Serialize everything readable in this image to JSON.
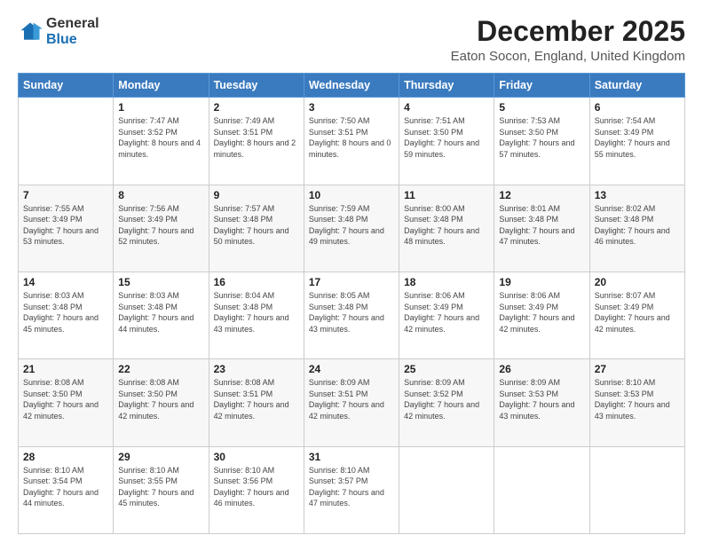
{
  "header": {
    "logo_line1": "General",
    "logo_line2": "Blue",
    "title": "December 2025",
    "subtitle": "Eaton Socon, England, United Kingdom"
  },
  "weekdays": [
    "Sunday",
    "Monday",
    "Tuesday",
    "Wednesday",
    "Thursday",
    "Friday",
    "Saturday"
  ],
  "weeks": [
    [
      {
        "day": "",
        "rise": "",
        "set": "",
        "daylight": ""
      },
      {
        "day": "1",
        "rise": "Sunrise: 7:47 AM",
        "set": "Sunset: 3:52 PM",
        "daylight": "Daylight: 8 hours and 4 minutes."
      },
      {
        "day": "2",
        "rise": "Sunrise: 7:49 AM",
        "set": "Sunset: 3:51 PM",
        "daylight": "Daylight: 8 hours and 2 minutes."
      },
      {
        "day": "3",
        "rise": "Sunrise: 7:50 AM",
        "set": "Sunset: 3:51 PM",
        "daylight": "Daylight: 8 hours and 0 minutes."
      },
      {
        "day": "4",
        "rise": "Sunrise: 7:51 AM",
        "set": "Sunset: 3:50 PM",
        "daylight": "Daylight: 7 hours and 59 minutes."
      },
      {
        "day": "5",
        "rise": "Sunrise: 7:53 AM",
        "set": "Sunset: 3:50 PM",
        "daylight": "Daylight: 7 hours and 57 minutes."
      },
      {
        "day": "6",
        "rise": "Sunrise: 7:54 AM",
        "set": "Sunset: 3:49 PM",
        "daylight": "Daylight: 7 hours and 55 minutes."
      }
    ],
    [
      {
        "day": "7",
        "rise": "Sunrise: 7:55 AM",
        "set": "Sunset: 3:49 PM",
        "daylight": "Daylight: 7 hours and 53 minutes."
      },
      {
        "day": "8",
        "rise": "Sunrise: 7:56 AM",
        "set": "Sunset: 3:49 PM",
        "daylight": "Daylight: 7 hours and 52 minutes."
      },
      {
        "day": "9",
        "rise": "Sunrise: 7:57 AM",
        "set": "Sunset: 3:48 PM",
        "daylight": "Daylight: 7 hours and 50 minutes."
      },
      {
        "day": "10",
        "rise": "Sunrise: 7:59 AM",
        "set": "Sunset: 3:48 PM",
        "daylight": "Daylight: 7 hours and 49 minutes."
      },
      {
        "day": "11",
        "rise": "Sunrise: 8:00 AM",
        "set": "Sunset: 3:48 PM",
        "daylight": "Daylight: 7 hours and 48 minutes."
      },
      {
        "day": "12",
        "rise": "Sunrise: 8:01 AM",
        "set": "Sunset: 3:48 PM",
        "daylight": "Daylight: 7 hours and 47 minutes."
      },
      {
        "day": "13",
        "rise": "Sunrise: 8:02 AM",
        "set": "Sunset: 3:48 PM",
        "daylight": "Daylight: 7 hours and 46 minutes."
      }
    ],
    [
      {
        "day": "14",
        "rise": "Sunrise: 8:03 AM",
        "set": "Sunset: 3:48 PM",
        "daylight": "Daylight: 7 hours and 45 minutes."
      },
      {
        "day": "15",
        "rise": "Sunrise: 8:03 AM",
        "set": "Sunset: 3:48 PM",
        "daylight": "Daylight: 7 hours and 44 minutes."
      },
      {
        "day": "16",
        "rise": "Sunrise: 8:04 AM",
        "set": "Sunset: 3:48 PM",
        "daylight": "Daylight: 7 hours and 43 minutes."
      },
      {
        "day": "17",
        "rise": "Sunrise: 8:05 AM",
        "set": "Sunset: 3:48 PM",
        "daylight": "Daylight: 7 hours and 43 minutes."
      },
      {
        "day": "18",
        "rise": "Sunrise: 8:06 AM",
        "set": "Sunset: 3:49 PM",
        "daylight": "Daylight: 7 hours and 42 minutes."
      },
      {
        "day": "19",
        "rise": "Sunrise: 8:06 AM",
        "set": "Sunset: 3:49 PM",
        "daylight": "Daylight: 7 hours and 42 minutes."
      },
      {
        "day": "20",
        "rise": "Sunrise: 8:07 AM",
        "set": "Sunset: 3:49 PM",
        "daylight": "Daylight: 7 hours and 42 minutes."
      }
    ],
    [
      {
        "day": "21",
        "rise": "Sunrise: 8:08 AM",
        "set": "Sunset: 3:50 PM",
        "daylight": "Daylight: 7 hours and 42 minutes."
      },
      {
        "day": "22",
        "rise": "Sunrise: 8:08 AM",
        "set": "Sunset: 3:50 PM",
        "daylight": "Daylight: 7 hours and 42 minutes."
      },
      {
        "day": "23",
        "rise": "Sunrise: 8:08 AM",
        "set": "Sunset: 3:51 PM",
        "daylight": "Daylight: 7 hours and 42 minutes."
      },
      {
        "day": "24",
        "rise": "Sunrise: 8:09 AM",
        "set": "Sunset: 3:51 PM",
        "daylight": "Daylight: 7 hours and 42 minutes."
      },
      {
        "day": "25",
        "rise": "Sunrise: 8:09 AM",
        "set": "Sunset: 3:52 PM",
        "daylight": "Daylight: 7 hours and 42 minutes."
      },
      {
        "day": "26",
        "rise": "Sunrise: 8:09 AM",
        "set": "Sunset: 3:53 PM",
        "daylight": "Daylight: 7 hours and 43 minutes."
      },
      {
        "day": "27",
        "rise": "Sunrise: 8:10 AM",
        "set": "Sunset: 3:53 PM",
        "daylight": "Daylight: 7 hours and 43 minutes."
      }
    ],
    [
      {
        "day": "28",
        "rise": "Sunrise: 8:10 AM",
        "set": "Sunset: 3:54 PM",
        "daylight": "Daylight: 7 hours and 44 minutes."
      },
      {
        "day": "29",
        "rise": "Sunrise: 8:10 AM",
        "set": "Sunset: 3:55 PM",
        "daylight": "Daylight: 7 hours and 45 minutes."
      },
      {
        "day": "30",
        "rise": "Sunrise: 8:10 AM",
        "set": "Sunset: 3:56 PM",
        "daylight": "Daylight: 7 hours and 46 minutes."
      },
      {
        "day": "31",
        "rise": "Sunrise: 8:10 AM",
        "set": "Sunset: 3:57 PM",
        "daylight": "Daylight: 7 hours and 47 minutes."
      },
      {
        "day": "",
        "rise": "",
        "set": "",
        "daylight": ""
      },
      {
        "day": "",
        "rise": "",
        "set": "",
        "daylight": ""
      },
      {
        "day": "",
        "rise": "",
        "set": "",
        "daylight": ""
      }
    ]
  ]
}
